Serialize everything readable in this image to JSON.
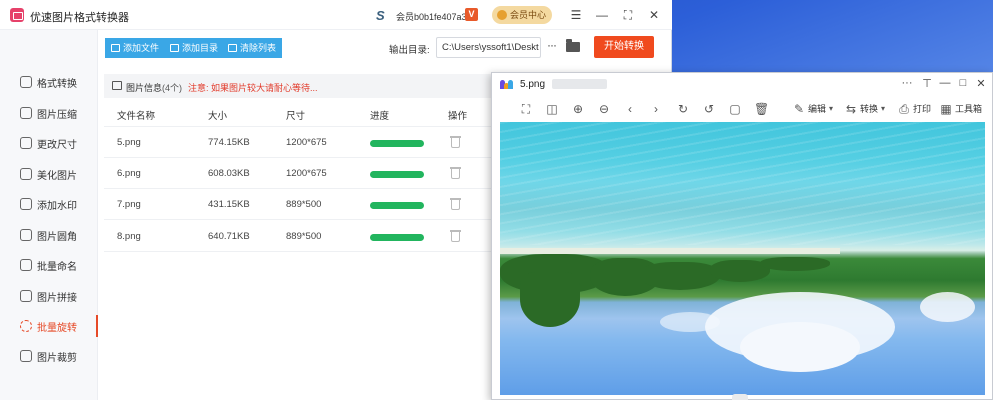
{
  "app": {
    "title": "优速图片格式转换器",
    "s_logo": "S",
    "member_id": "会员b0b1fe407a3c",
    "vip_badge": "V",
    "member_center": "会员中心"
  },
  "window_controls": {
    "menu": "☰",
    "minimize": "—",
    "maximize": "⛶",
    "close": "✕"
  },
  "sidebar": {
    "items": [
      {
        "label": "格式转换"
      },
      {
        "label": "图片压缩"
      },
      {
        "label": "更改尺寸"
      },
      {
        "label": "美化图片"
      },
      {
        "label": "添加水印"
      },
      {
        "label": "图片圆角"
      },
      {
        "label": "批量命名"
      },
      {
        "label": "图片拼接"
      },
      {
        "label": "批量旋转",
        "active": true
      },
      {
        "label": "图片裁剪"
      }
    ]
  },
  "toolbar": {
    "add_file": "添加文件",
    "add_dir": "添加目录",
    "clear_list": "清除列表",
    "output_label": "输出目录:",
    "output_path": "C:\\Users\\yssoft1\\Deskt",
    "more": "···",
    "start": "开始转换"
  },
  "info_bar": {
    "title": "图片信息",
    "count": "(4个)",
    "warning": "注意: 如果图片较大请耐心等待..."
  },
  "table": {
    "headers": [
      "文件名称",
      "大小",
      "尺寸",
      "进度",
      "操作"
    ],
    "rows": [
      {
        "name": "5.png",
        "size": "774.15KB",
        "dims": "1200*675",
        "progress": 1.0
      },
      {
        "name": "6.png",
        "size": "608.03KB",
        "dims": "1200*675",
        "progress": 1.0
      },
      {
        "name": "7.png",
        "size": "431.15KB",
        "dims": "889*500",
        "progress": 1.0
      },
      {
        "name": "8.png",
        "size": "640.71KB",
        "dims": "889*500",
        "progress": 1.0
      }
    ]
  },
  "viewer": {
    "filename": "5.png",
    "controls": {
      "more": "···",
      "pin": "⊤",
      "minimize": "—",
      "maximize": "□",
      "close": "✕"
    },
    "tools": {
      "edit": "编辑",
      "convert": "转换",
      "print": "打印",
      "toolbox": "工具箱"
    }
  },
  "colors": {
    "accent_red": "#f04a1e",
    "tool_blue": "#3aa7e6",
    "progress_green": "#22b55e",
    "warning_red": "#e23a2a",
    "logo_pink": "#e6416a"
  }
}
